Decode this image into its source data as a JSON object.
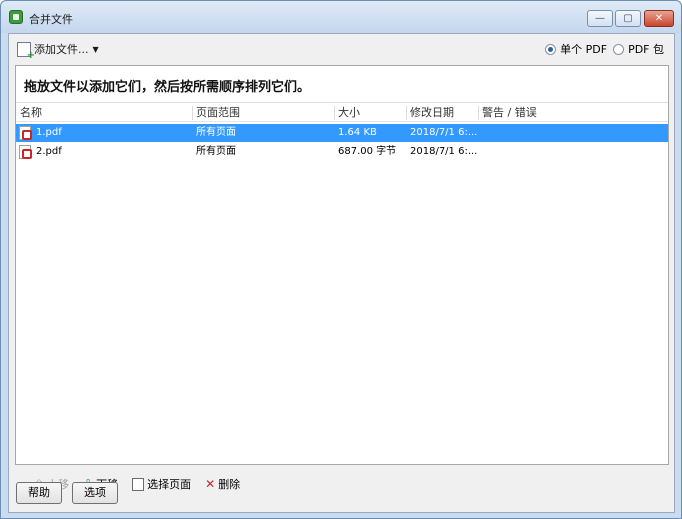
{
  "window": {
    "title": "合并文件",
    "controls": {
      "min": "—",
      "max": "▢",
      "close": "✕"
    }
  },
  "toolbar": {
    "add_files_label": "添加文件...",
    "output_options": [
      {
        "label": "单个 PDF",
        "checked": true
      },
      {
        "label": "PDF 包",
        "checked": false
      }
    ]
  },
  "panel": {
    "instruction": "拖放文件以添加它们，然后按所需顺序排列它们。",
    "columns": [
      "名称",
      "页面范围",
      "大小",
      "修改日期",
      "警告 / 错误"
    ],
    "rows": [
      {
        "name": "1.pdf",
        "page_range": "所有页面",
        "size": "1.64 KB",
        "modified": "2018/7/1 6:...",
        "warning": "",
        "selected": true
      },
      {
        "name": "2.pdf",
        "page_range": "所有页面",
        "size": "687.00 字节",
        "modified": "2018/7/1 6:...",
        "warning": "",
        "selected": false
      }
    ]
  },
  "actions": {
    "up": "上移",
    "down": "下移",
    "select_pages": "选择页面",
    "delete": "删除"
  },
  "footer": {
    "help": "帮助",
    "options": "选项"
  },
  "colors": {
    "selection": "#3399ff",
    "window_frame": "#c9dcf0"
  }
}
